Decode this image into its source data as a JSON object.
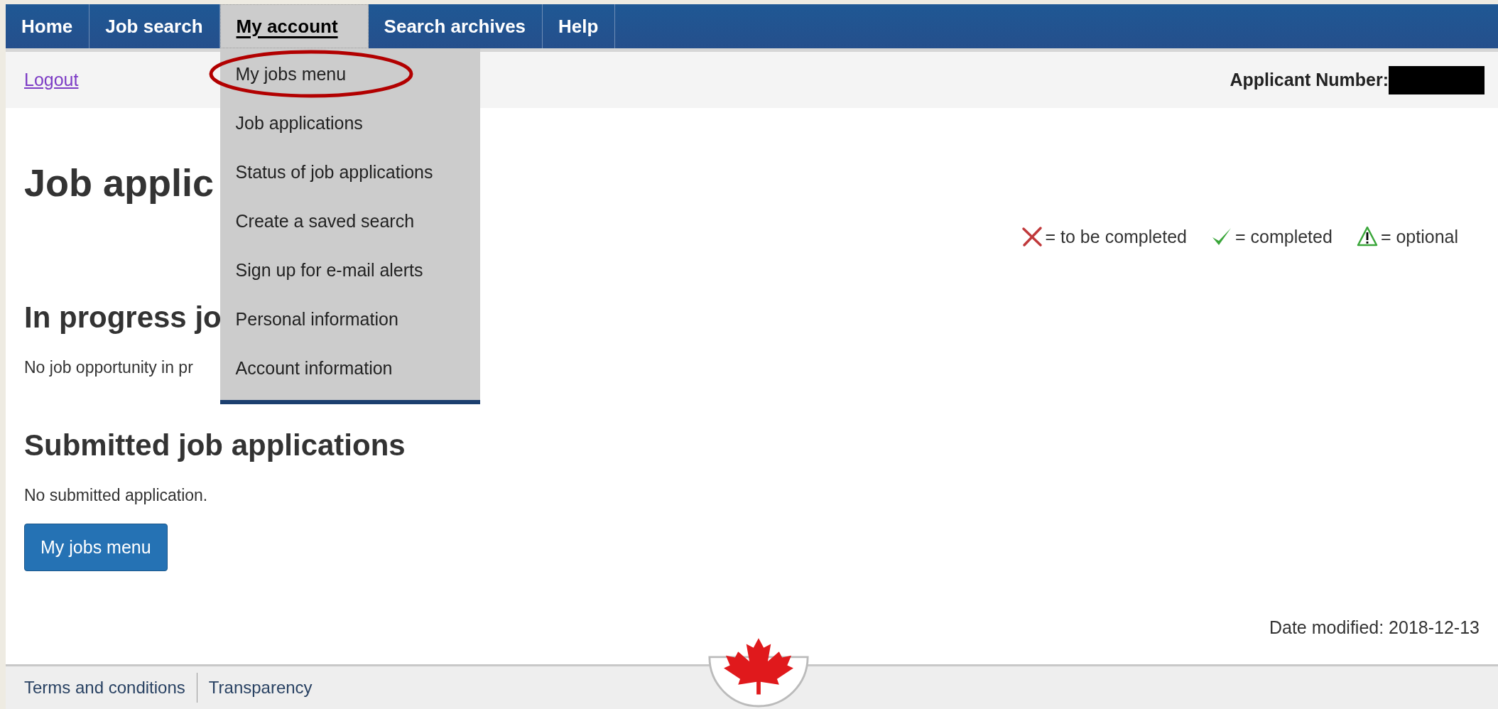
{
  "nav": {
    "items": [
      {
        "label": "Home",
        "selected": false
      },
      {
        "label": "Job search",
        "selected": false
      },
      {
        "label": "My account",
        "selected": true
      },
      {
        "label": "Search archives",
        "selected": false
      },
      {
        "label": "Help",
        "selected": false
      }
    ]
  },
  "menu": {
    "items": [
      {
        "label": "My jobs menu",
        "circled": true
      },
      {
        "label": "Job applications",
        "circled": false
      },
      {
        "label": "Status of job applications",
        "circled": false
      },
      {
        "label": "Create a saved search",
        "circled": false
      },
      {
        "label": "Sign up for e-mail alerts",
        "circled": false
      },
      {
        "label": "Personal information",
        "circled": false
      },
      {
        "label": "Account information",
        "circled": false
      }
    ]
  },
  "subbar": {
    "logout": "Logout",
    "applicant_label": "Applicant Number:"
  },
  "heading": "Job applic",
  "legend": [
    {
      "kind": "cross",
      "text": "= to be completed"
    },
    {
      "kind": "check",
      "text": "= completed"
    },
    {
      "kind": "warning",
      "text": "= optional"
    }
  ],
  "sections": [
    {
      "heading": "In progress jo",
      "text": "No job opportunity in pr"
    },
    {
      "heading": "Submitted job applications",
      "text": "No submitted application."
    }
  ],
  "button": "My jobs menu",
  "date_modified": "Date modified: 2018-12-13",
  "footer": {
    "links": [
      "Terms and conditions",
      "Transparency"
    ]
  }
}
